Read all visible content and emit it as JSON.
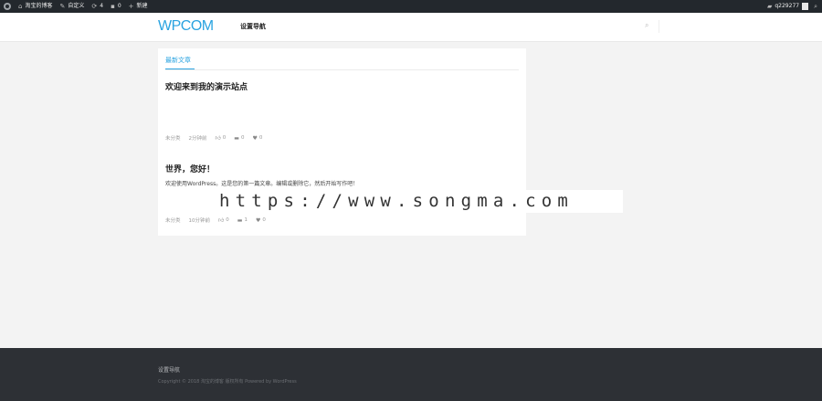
{
  "adminbar": {
    "site_name": "淘宝的博客",
    "customize": "自定义",
    "updates_count": "4",
    "comments_count": "0",
    "new_label": "新建",
    "user_name": "q229277"
  },
  "header": {
    "logo": "WPCOM",
    "nav_item": "设置导航"
  },
  "main": {
    "tab_label": "最新文章",
    "posts": [
      {
        "title": "欢迎来到我的演示站点",
        "excerpt": "",
        "category": "未分类",
        "time": "2分钟前",
        "likes": "0",
        "comments": "0",
        "favorites": "0"
      },
      {
        "title": "世界，您好！",
        "excerpt": "欢迎使用WordPress。这是您的第一篇文章。编辑或删除它，然后开始写作吧！",
        "category": "未分类",
        "time": "10分钟前",
        "likes": "0",
        "comments": "1",
        "favorites": "0"
      }
    ]
  },
  "watermark": "https://www.songma.com",
  "footer": {
    "nav_item": "设置导航",
    "copyright": "Copyright © 2018 淘宝的博客 版权所有 Powered by WordPress"
  },
  "colors": {
    "accent": "#2aa3e0",
    "adminbar_bg": "#23282d",
    "footer_bg": "#2d3035",
    "page_bg": "#f3f3f3"
  }
}
